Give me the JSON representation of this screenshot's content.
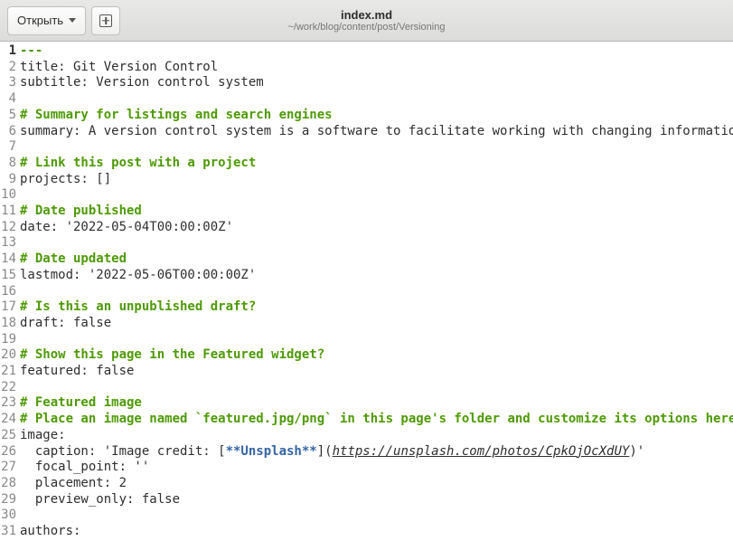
{
  "titlebar": {
    "open_label": "Открыть",
    "file_title": "index.md",
    "file_path": "~/work/blog/content/post/Versioning"
  },
  "lines": [
    {
      "n": 1,
      "current": true,
      "segs": [
        {
          "cls": "green",
          "t": "---"
        }
      ]
    },
    {
      "n": 2,
      "segs": [
        {
          "cls": "text",
          "t": "title: Git Version Control"
        }
      ]
    },
    {
      "n": 3,
      "segs": [
        {
          "cls": "text",
          "t": "subtitle: Version control system"
        }
      ]
    },
    {
      "n": 4,
      "segs": []
    },
    {
      "n": 5,
      "segs": [
        {
          "cls": "green",
          "t": "# Summary for listings and search engines"
        }
      ]
    },
    {
      "n": 6,
      "segs": [
        {
          "cls": "text",
          "t": "summary: A version control system is a software to facilitate working with changing information."
        }
      ]
    },
    {
      "n": 7,
      "segs": []
    },
    {
      "n": 8,
      "segs": [
        {
          "cls": "green",
          "t": "# Link this post with a project"
        }
      ]
    },
    {
      "n": 9,
      "segs": [
        {
          "cls": "text",
          "t": "projects: []"
        }
      ]
    },
    {
      "n": 10,
      "segs": []
    },
    {
      "n": 11,
      "segs": [
        {
          "cls": "green",
          "t": "# Date published"
        }
      ]
    },
    {
      "n": 12,
      "segs": [
        {
          "cls": "text",
          "t": "date: '2022-05-04T00:00:00Z'"
        }
      ]
    },
    {
      "n": 13,
      "segs": []
    },
    {
      "n": 14,
      "segs": [
        {
          "cls": "green",
          "t": "# Date updated"
        }
      ]
    },
    {
      "n": 15,
      "segs": [
        {
          "cls": "text",
          "t": "lastmod: '2022-05-06T00:00:00Z'"
        }
      ]
    },
    {
      "n": 16,
      "segs": []
    },
    {
      "n": 17,
      "segs": [
        {
          "cls": "green",
          "t": "# Is this an unpublished draft?"
        }
      ]
    },
    {
      "n": 18,
      "segs": [
        {
          "cls": "text",
          "t": "draft: false"
        }
      ]
    },
    {
      "n": 19,
      "segs": []
    },
    {
      "n": 20,
      "segs": [
        {
          "cls": "green",
          "t": "# Show this page in the Featured widget?"
        }
      ]
    },
    {
      "n": 21,
      "segs": [
        {
          "cls": "text",
          "t": "featured: false"
        }
      ]
    },
    {
      "n": 22,
      "segs": []
    },
    {
      "n": 23,
      "segs": [
        {
          "cls": "green",
          "t": "# Featured image"
        }
      ]
    },
    {
      "n": 24,
      "segs": [
        {
          "cls": "green",
          "t": "# Place an image named `featured.jpg/png` in this page's folder and customize its options here."
        }
      ]
    },
    {
      "n": 25,
      "segs": [
        {
          "cls": "text",
          "t": "image:"
        }
      ]
    },
    {
      "n": 26,
      "segs": [
        {
          "cls": "text",
          "t": "  caption: 'Image credit: ["
        },
        {
          "cls": "blue-bold",
          "t": "**Unsplash**"
        },
        {
          "cls": "text",
          "t": "]("
        },
        {
          "cls": "italic-underline",
          "t": "https://unsplash.com/photos/CpkOjOcXdUY"
        },
        {
          "cls": "text",
          "t": ")'"
        }
      ]
    },
    {
      "n": 27,
      "segs": [
        {
          "cls": "text",
          "t": "  focal_point: ''"
        }
      ]
    },
    {
      "n": 28,
      "segs": [
        {
          "cls": "text",
          "t": "  placement: 2"
        }
      ]
    },
    {
      "n": 29,
      "segs": [
        {
          "cls": "text",
          "t": "  preview_only: false"
        }
      ]
    },
    {
      "n": 30,
      "segs": []
    },
    {
      "n": 31,
      "segs": [
        {
          "cls": "text",
          "t": "authors:"
        }
      ]
    }
  ]
}
